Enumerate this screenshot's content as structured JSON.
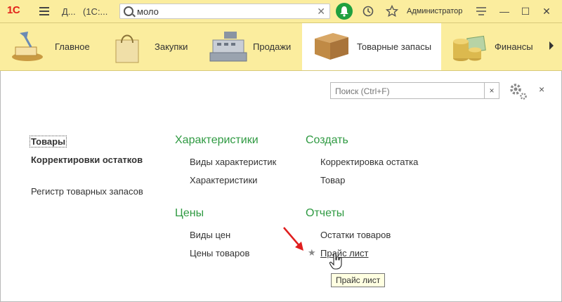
{
  "topbar": {
    "logo": "1С",
    "title_short": "Д...",
    "title_app": "(1С:...",
    "search_value": "моло",
    "user": "Администратор"
  },
  "sections": [
    {
      "label": "Главное",
      "icon": "desk-lamp-icon"
    },
    {
      "label": "Закупки",
      "icon": "shopping-bag-icon"
    },
    {
      "label": "Продажи",
      "icon": "cash-register-icon"
    },
    {
      "label": "Товарные запасы",
      "icon": "box-icon",
      "active": true
    },
    {
      "label": "Финансы",
      "icon": "coins-icon"
    }
  ],
  "work": {
    "search_placeholder": "Поиск (Ctrl+F)",
    "clear": "×",
    "close": "×",
    "left_links": [
      "Товары",
      "Корректировки остатков",
      "Регистр товарных запасов"
    ],
    "groups": {
      "characteristics": {
        "title": "Характеристики",
        "items": [
          "Виды характеристик",
          "Характеристики"
        ]
      },
      "prices": {
        "title": "Цены",
        "items": [
          "Виды цен",
          "Цены товаров"
        ]
      },
      "create": {
        "title": "Создать",
        "items": [
          "Корректировка остатка",
          "Товар"
        ]
      },
      "reports": {
        "title": "Отчеты",
        "items": [
          "Остатки товаров",
          "Прайс лист"
        ]
      }
    },
    "tooltip": "Прайс лист"
  },
  "colors": {
    "accent_yellow": "#fbed9e",
    "group_green": "#2f9a42",
    "notification_green": "#1fa03f",
    "logo_red": "#e2231a",
    "annotation_red": "#e01e1e"
  }
}
